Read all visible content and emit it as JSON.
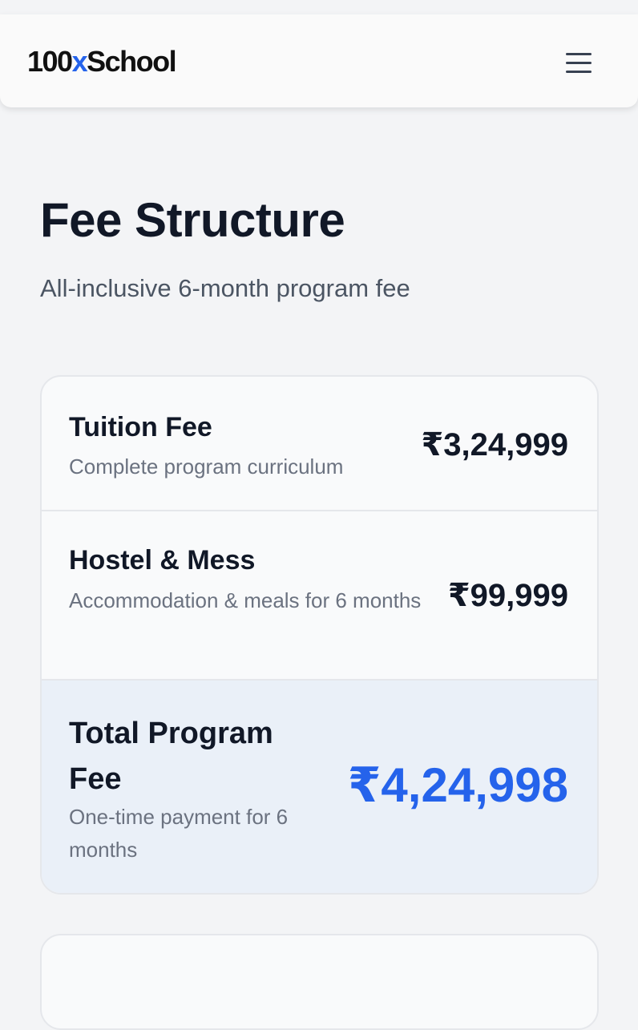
{
  "header": {
    "logo_prefix": "100",
    "logo_accent": "x",
    "logo_suffix": "School",
    "menu_icon": "hamburger-menu-icon",
    "accent_color": "#2563eb"
  },
  "page": {
    "title": "Fee Structure",
    "subtitle": "All-inclusive 6-month program fee"
  },
  "fees": [
    {
      "label": "Tuition Fee",
      "description": "Complete program curriculum",
      "amount": "₹3,24,999"
    },
    {
      "label": "Hostel & Mess",
      "description": "Accommodation & meals for 6 months",
      "amount": "₹99,999"
    }
  ],
  "total": {
    "label": "Total Program Fee",
    "description": "One-time payment for 6 months",
    "amount": "₹4,24,998"
  }
}
